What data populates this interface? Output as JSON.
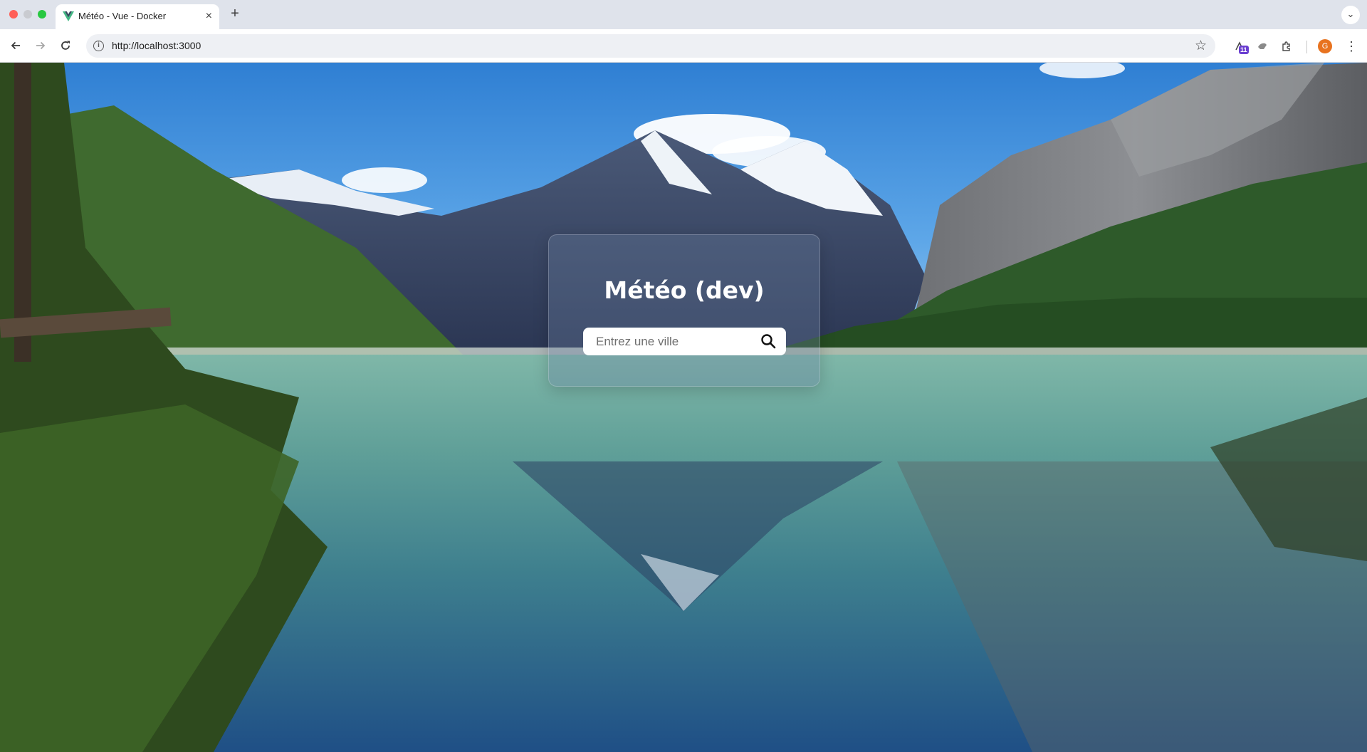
{
  "browser": {
    "tab_title": "Météo - Vue - Docker",
    "tab_close": "×",
    "new_tab": "+",
    "tab_menu": "⌄",
    "url": "http://localhost:3000",
    "extension_badge": "11",
    "profile_initial": "G",
    "icons": [
      "back-arrow-icon",
      "forward-arrow-icon",
      "reload-icon",
      "site-info-icon",
      "bookmark-star-icon",
      "extension-icon",
      "puzzle-icon",
      "kebab-menu-icon"
    ]
  },
  "page": {
    "heading": "Météo (dev)",
    "search": {
      "placeholder": "Entrez une ville",
      "value": ""
    }
  },
  "colors": {
    "card_bg": "#6e82a5",
    "sky": "#3f8ad6",
    "accent_vue": "#42b883"
  }
}
